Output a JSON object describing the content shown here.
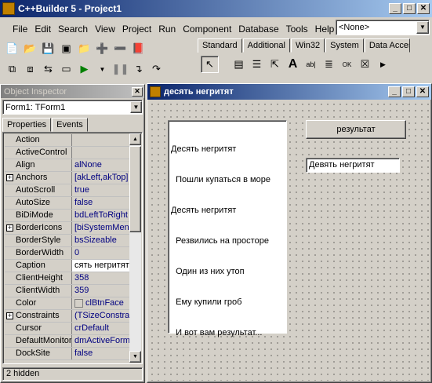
{
  "app": {
    "title": "C++Builder 5 - Project1",
    "menu": [
      "File",
      "Edit",
      "Search",
      "View",
      "Project",
      "Run",
      "Component",
      "Database",
      "Tools",
      "Help"
    ],
    "config_combo": "<None>",
    "palette_tabs": [
      "Standard",
      "Additional",
      "Win32",
      "System",
      "Data Access"
    ]
  },
  "inspector": {
    "title": "Object Inspector",
    "object_combo": "Form1: TForm1",
    "tabs": [
      "Properties",
      "Events"
    ],
    "rows": [
      {
        "name": "Action",
        "value": "",
        "expand": false
      },
      {
        "name": "ActiveControl",
        "value": "",
        "expand": false
      },
      {
        "name": "Align",
        "value": "alNone",
        "expand": false
      },
      {
        "name": "Anchors",
        "value": "[akLeft,akTop]",
        "expand": true
      },
      {
        "name": "AutoScroll",
        "value": "true",
        "expand": false
      },
      {
        "name": "AutoSize",
        "value": "false",
        "expand": false
      },
      {
        "name": "BiDiMode",
        "value": "bdLeftToRight",
        "expand": false
      },
      {
        "name": "BorderIcons",
        "value": "[biSystemMenu,",
        "expand": true
      },
      {
        "name": "BorderStyle",
        "value": "bsSizeable",
        "expand": false
      },
      {
        "name": "BorderWidth",
        "value": "0",
        "expand": false
      },
      {
        "name": "Caption",
        "value": "сять негритят",
        "expand": false
      },
      {
        "name": "ClientHeight",
        "value": "358",
        "expand": false
      },
      {
        "name": "ClientWidth",
        "value": "359",
        "expand": false
      },
      {
        "name": "Color",
        "value": "clBtnFace",
        "expand": false
      },
      {
        "name": "Constraints",
        "value": "(TSizeConstrain",
        "expand": true
      },
      {
        "name": "Cursor",
        "value": "crDefault",
        "expand": false
      },
      {
        "name": "DefaultMonitor",
        "value": "dmActiveForm",
        "expand": false
      },
      {
        "name": "DockSite",
        "value": "false",
        "expand": false
      }
    ],
    "status": "2 hidden"
  },
  "form": {
    "title": "десять негритят",
    "memo_lines": [
      "Десять негритят",
      "  Пошли купаться в море",
      "Десять негритят",
      "  Резвились на просторе",
      "  Один из них утоп",
      "  Ему купили гроб",
      "  И вот вам результат..."
    ],
    "button_label": "результат",
    "edit_value": "Девять негритят"
  }
}
